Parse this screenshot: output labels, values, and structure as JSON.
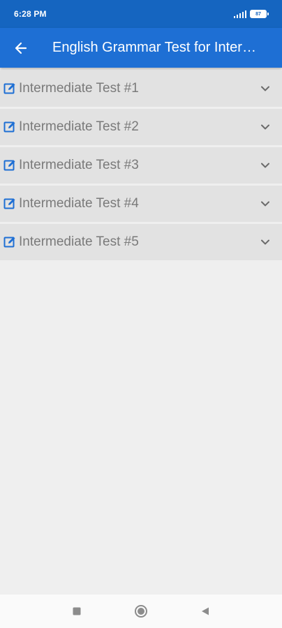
{
  "status": {
    "time": "6:28 PM",
    "battery": "87"
  },
  "app_bar": {
    "title": "English Grammar Test for Inter…"
  },
  "tests": [
    {
      "label": "Intermediate Test #1"
    },
    {
      "label": "Intermediate Test #2"
    },
    {
      "label": "Intermediate Test #3"
    },
    {
      "label": "Intermediate Test #4"
    },
    {
      "label": "Intermediate Test #5"
    }
  ],
  "colors": {
    "status_bar": "#1565c0",
    "app_bar": "#1e6fd4",
    "accent_icon": "#1e6fd4",
    "item_background": "#e2e2e2",
    "item_text": "#7a7a7a",
    "page_background": "#efefef"
  },
  "icons": {
    "back": "arrow-left-icon",
    "edit": "edit-square-icon",
    "expand": "chevron-down-icon",
    "nav_recents": "square-icon",
    "nav_home": "circle-icon",
    "nav_back": "triangle-back-icon"
  }
}
